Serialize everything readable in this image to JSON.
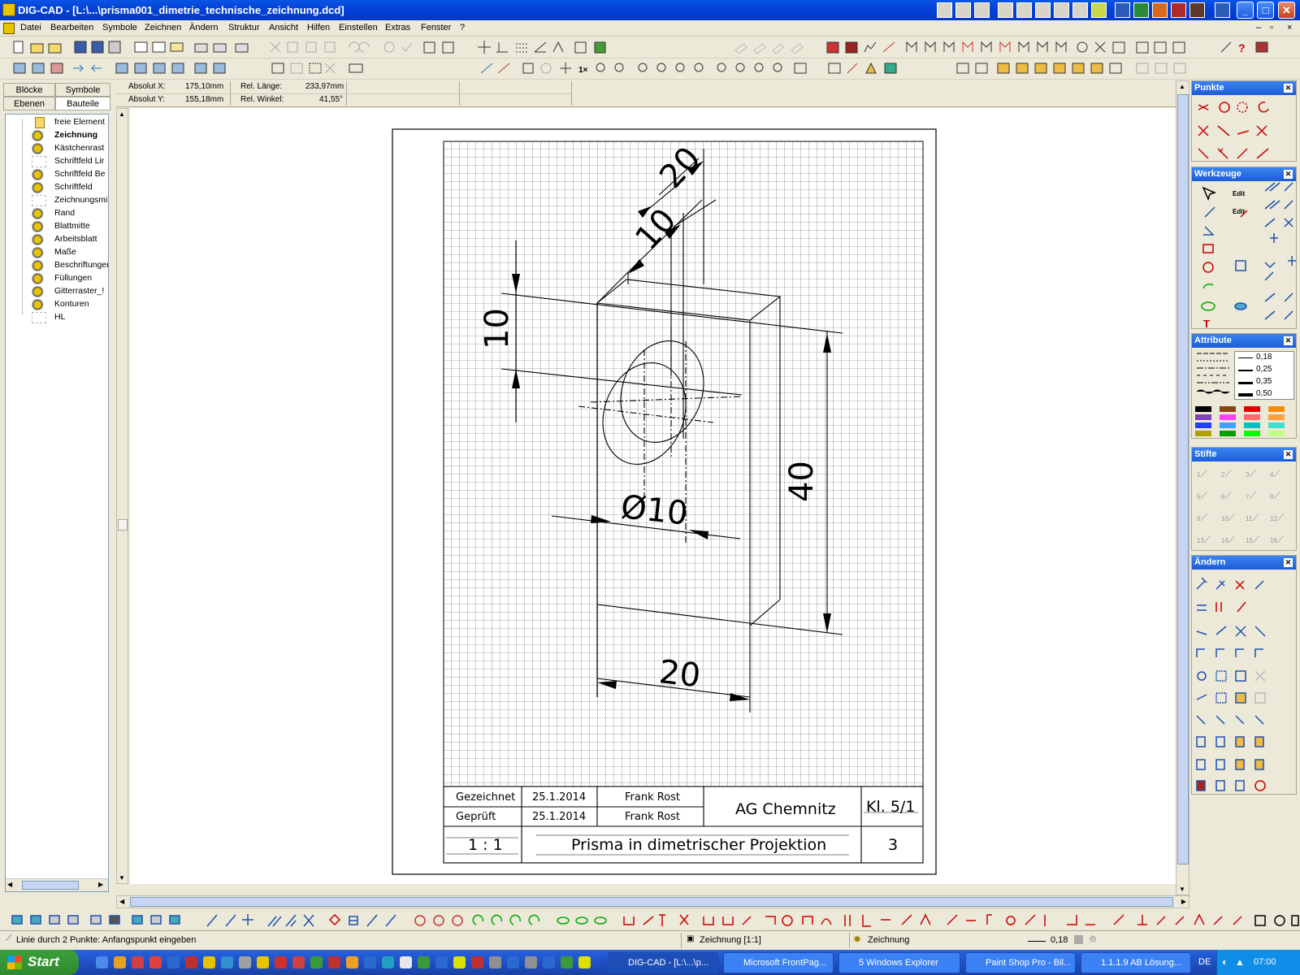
{
  "window": {
    "title": "DIG-CAD - [L:\\...\\prisma001_dimetrie_technische_zeichnung.dcd]"
  },
  "menu": [
    "Datei",
    "Bearbeiten",
    "Symbole",
    "Zeichnen",
    "Ändern",
    "Struktur",
    "Ansicht",
    "Hilfen",
    "Einstellen",
    "Extras",
    "Fenster",
    "?"
  ],
  "info": {
    "abs_x_label": "Absolut X:",
    "abs_x": "175,10mm",
    "abs_y_label": "Absolut Y:",
    "abs_y": "155,18mm",
    "rel_len_label": "Rel. Länge:",
    "rel_len": "233,97mm",
    "rel_ang_label": "Rel. Winkel:",
    "rel_ang": "41,55°"
  },
  "left_tabs": {
    "bloecke": "Blöcke",
    "symbole": "Symbole",
    "ebenen": "Ebenen",
    "bauteile": "Bauteile"
  },
  "layers": [
    "freie Element",
    "Zeichnung",
    "Kästchenrast",
    "Schriftfeld Lir",
    "Schriftfeld Be",
    "Schriftfeld",
    "Zeichnungsmi",
    "Rand",
    "Blattmitte",
    "Arbeitsblatt",
    "Maße",
    "Beschriftunger",
    "Füllungen",
    "Gitterraster_!",
    "Konturen",
    "HL"
  ],
  "drawing": {
    "dims": {
      "d20_top": "20",
      "d10_top": "10",
      "d10_left": "10",
      "d40": "40",
      "dia": "Ø10",
      "d20_bottom": "20"
    },
    "titleblock": {
      "gez_label": "Gezeichnet",
      "gez_date": "25.1.2014",
      "gez_name": "Frank Rost",
      "gep_label": "Geprüft",
      "gep_date": "25.1.2014",
      "gep_name": "Frank Rost",
      "school": "AG Chemnitz",
      "klasse": "Kl. 5/1",
      "scale": "1 : 1",
      "title": "Prisma in dimetrischer Projektion",
      "sheet": "3"
    }
  },
  "panels": {
    "punkte": "Punkte",
    "werkzeuge": "Werkzeuge",
    "attribute": "Attribute",
    "stifte": "Stifte",
    "aendern": "Ändern",
    "line_widths": [
      "0,18",
      "0,25",
      "0,35",
      "0,50"
    ],
    "pens": [
      "1",
      "2",
      "3",
      "4",
      "5",
      "6",
      "7",
      "8",
      "9",
      "10",
      "11",
      "12",
      "13",
      "14",
      "15",
      "16"
    ]
  },
  "status": {
    "hint": "Linie durch 2 Punkte: Anfangspunkt eingeben",
    "view": "Zeichnung [1:1]",
    "layer": "Zeichnung",
    "width": "0,18"
  },
  "taskbar": {
    "start": "Start",
    "tasks": [
      "DIG-CAD - [L:\\...\\p...",
      "Microsoft FrontPag...",
      "5 Windows Explorer",
      "Paint Shop Pro - Bil...",
      "1.1.1.9 AB Lösung..."
    ],
    "lang": "DE",
    "clock": "07:00"
  }
}
